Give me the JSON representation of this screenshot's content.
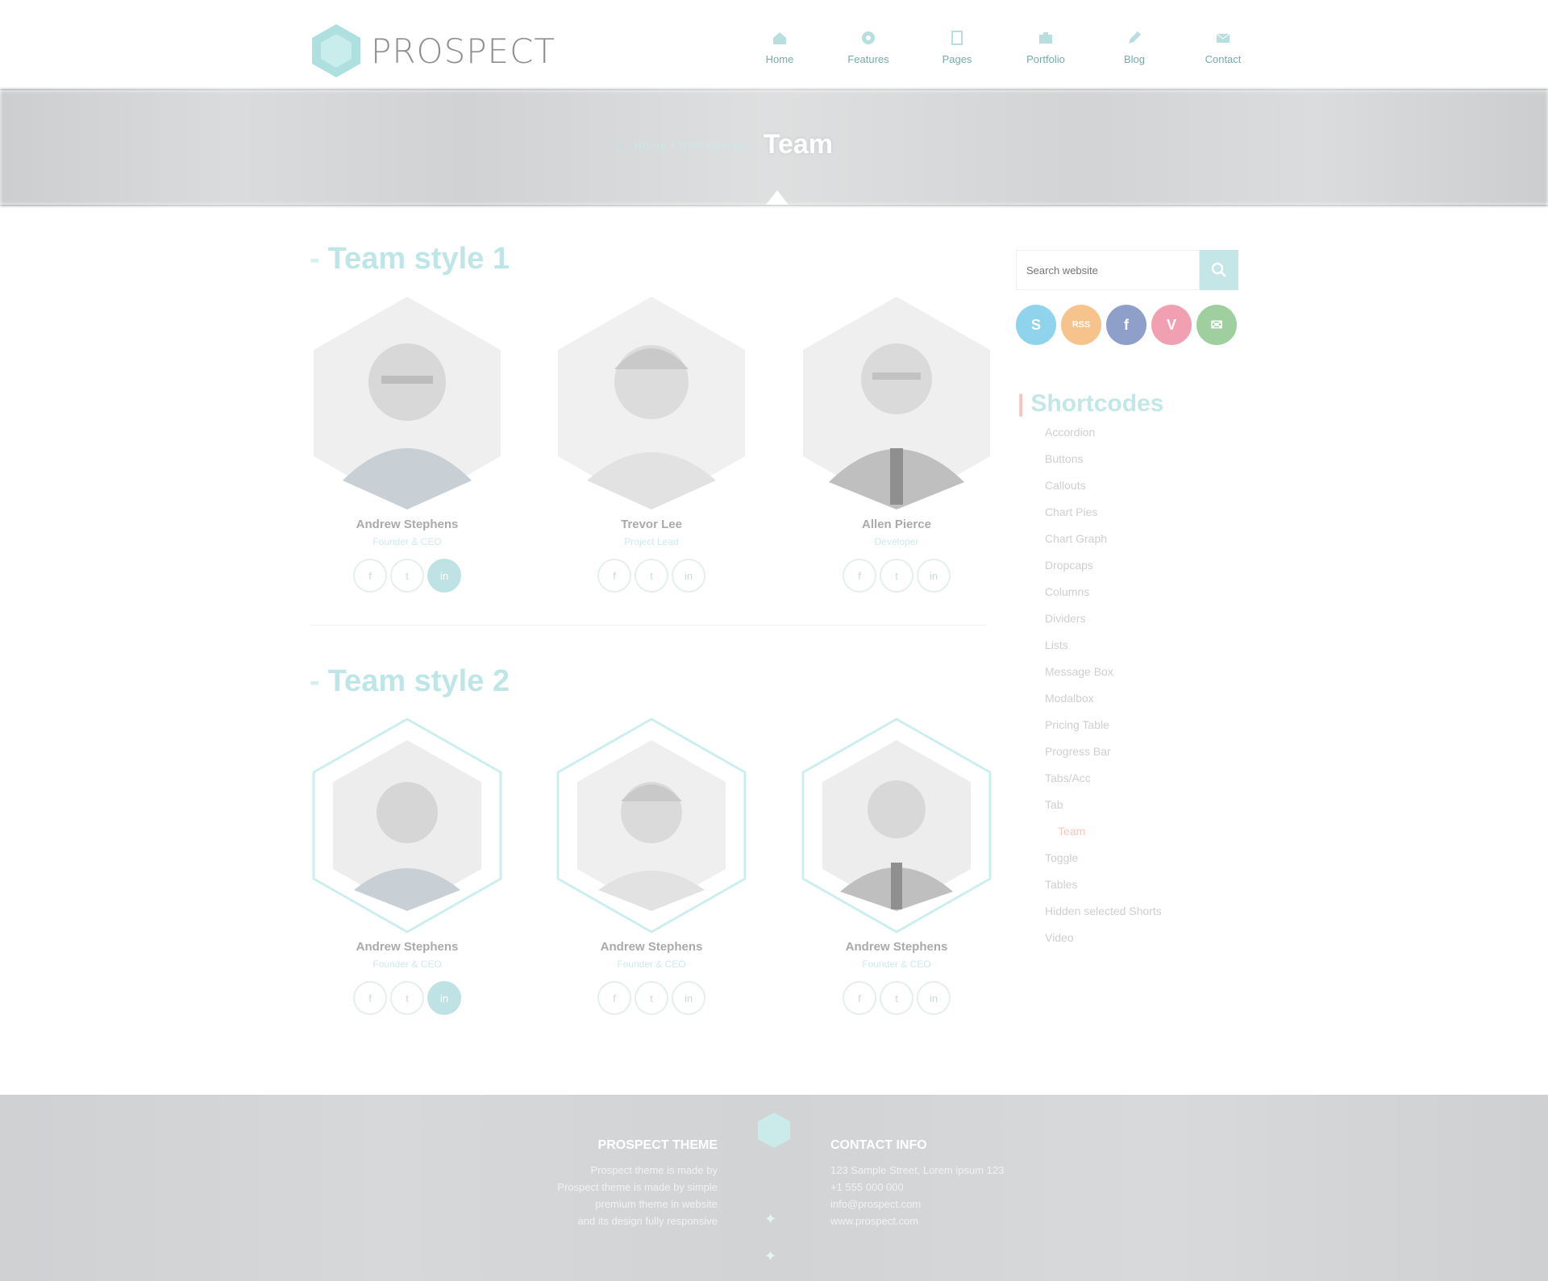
{
  "header": {
    "logo_text": "PROSPECT",
    "nav": [
      {
        "label": "Home",
        "icon": "home-icon"
      },
      {
        "label": "Features",
        "icon": "gear-icon"
      },
      {
        "label": "Pages",
        "icon": "file-icon"
      },
      {
        "label": "Portfolio",
        "icon": "briefcase-icon"
      },
      {
        "label": "Blog",
        "icon": "pencil-icon"
      },
      {
        "label": "Contact",
        "icon": "envelope-icon"
      }
    ]
  },
  "banner": {
    "home_glyph": "⌂",
    "trail": "Home  /  Shortcodes  /",
    "current": "Team"
  },
  "team1": {
    "title": "Team style 1",
    "members": [
      {
        "name": "Andrew Stephens",
        "role": "Founder & CEO",
        "socials": [
          "f",
          "t",
          "in"
        ]
      },
      {
        "name": "Trevor Lee",
        "role": "Project Lead",
        "socials": [
          "f",
          "t",
          "in"
        ]
      },
      {
        "name": "Allen Pierce",
        "role": "Developer",
        "socials": [
          "f",
          "t",
          "in"
        ]
      }
    ]
  },
  "team2": {
    "title": "Team style 2",
    "members": [
      {
        "name": "Andrew Stephens",
        "role": "Founder & CEO",
        "socials": [
          "f",
          "t",
          "in"
        ]
      },
      {
        "name": "Andrew Stephens",
        "role": "Founder & CEO",
        "socials": [
          "f",
          "t",
          "in"
        ]
      },
      {
        "name": "Andrew Stephens",
        "role": "Founder & CEO",
        "socials": [
          "f",
          "t",
          "in"
        ]
      }
    ]
  },
  "sidebar": {
    "search_placeholder": "Search website",
    "social": [
      {
        "glyph": "S",
        "color": "#8fd3ec",
        "icon": "skype-icon"
      },
      {
        "glyph": "RSS",
        "color": "#f7c38c",
        "icon": "rss-icon"
      },
      {
        "glyph": "f",
        "color": "#8e9fc9",
        "icon": "facebook-icon"
      },
      {
        "glyph": "V",
        "color": "#f0a0b0",
        "icon": "vimeo-icon"
      },
      {
        "glyph": "✉",
        "color": "#9fcf9f",
        "icon": "mail-icon"
      }
    ],
    "widget_title": "Shortcodes",
    "shortcodes": [
      "Accordion",
      "Buttons",
      "Callouts",
      "Chart Pies",
      "Chart Graph",
      "Dropcaps",
      "Columns",
      "Dividers",
      "Lists",
      "Message Box",
      "Modalbox",
      "Pricing Table",
      "Progress Bar",
      "Tabs/Acc",
      "Tab",
      "Team",
      "Toggle",
      "Tables",
      "Hidden selected Shorts",
      "Video"
    ],
    "current_shortcode": "Team"
  },
  "footer": {
    "left_heading": "PROSPECT THEME",
    "left_lines": [
      "Prospect theme is made by",
      "Prospect theme is made by simple",
      "premium theme in website",
      "and its design fully responsive"
    ],
    "right_heading": "CONTACT INFO",
    "right_lines": [
      "123 Sample Street, Lorem ipsum 123",
      "+1 555 000 000",
      "info@prospect.com",
      "www.prospect.com"
    ]
  }
}
